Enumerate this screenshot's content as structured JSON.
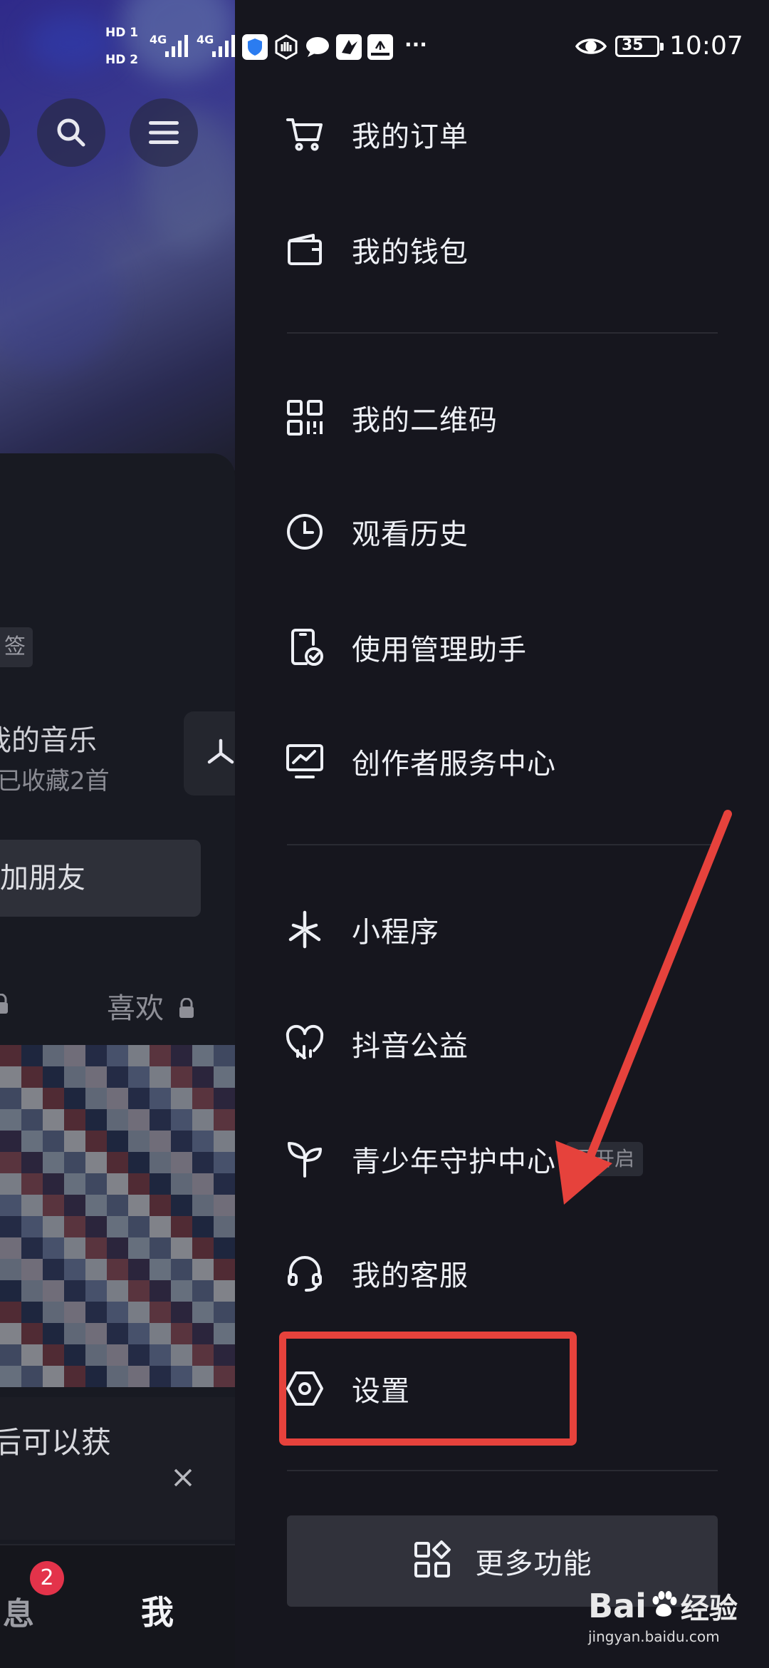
{
  "status_bar": {
    "sim1": "HD 1",
    "sim2": "HD 2",
    "net1": "4G",
    "net2": "4G",
    "battery": "35",
    "time": "10:07",
    "more": "···"
  },
  "background_page": {
    "tag_fragment": "签",
    "music_title_fragment": "我的音乐",
    "music_sub_fragment": "已收藏2首",
    "add_friend_fragment": "加朋友",
    "likes_fragment": "喜欢",
    "banner_fragment": "后可以获",
    "tab_messages_fragment": "息",
    "tab_me": "我",
    "message_badge": "2"
  },
  "drawer": {
    "group1": [
      {
        "label": "我的订单",
        "icon": "cart-icon"
      },
      {
        "label": "我的钱包",
        "icon": "wallet-icon"
      }
    ],
    "group2": [
      {
        "label": "我的二维码",
        "icon": "qr-code-icon"
      },
      {
        "label": "观看历史",
        "icon": "clock-icon"
      },
      {
        "label": "使用管理助手",
        "icon": "phone-check-icon"
      },
      {
        "label": "创作者服务中心",
        "icon": "creator-chart-icon"
      }
    ],
    "group3": [
      {
        "label": "小程序",
        "icon": "mini-program-icon"
      },
      {
        "label": "抖音公益",
        "icon": "heart-chart-icon"
      },
      {
        "label": "青少年守护中心",
        "icon": "sprout-icon",
        "badge": "已开启"
      },
      {
        "label": "我的客服",
        "icon": "headset-icon"
      },
      {
        "label": "设置",
        "icon": "settings-hexagon-icon"
      }
    ],
    "more_button": "更多功能"
  },
  "watermark": {
    "brand_left": "Bai",
    "brand_right": "经验",
    "url": "jingyan.baidu.com"
  },
  "colors": {
    "drawer_bg": "#16161e",
    "annotation_red": "#e6423c",
    "badge_red": "#e3334a"
  }
}
